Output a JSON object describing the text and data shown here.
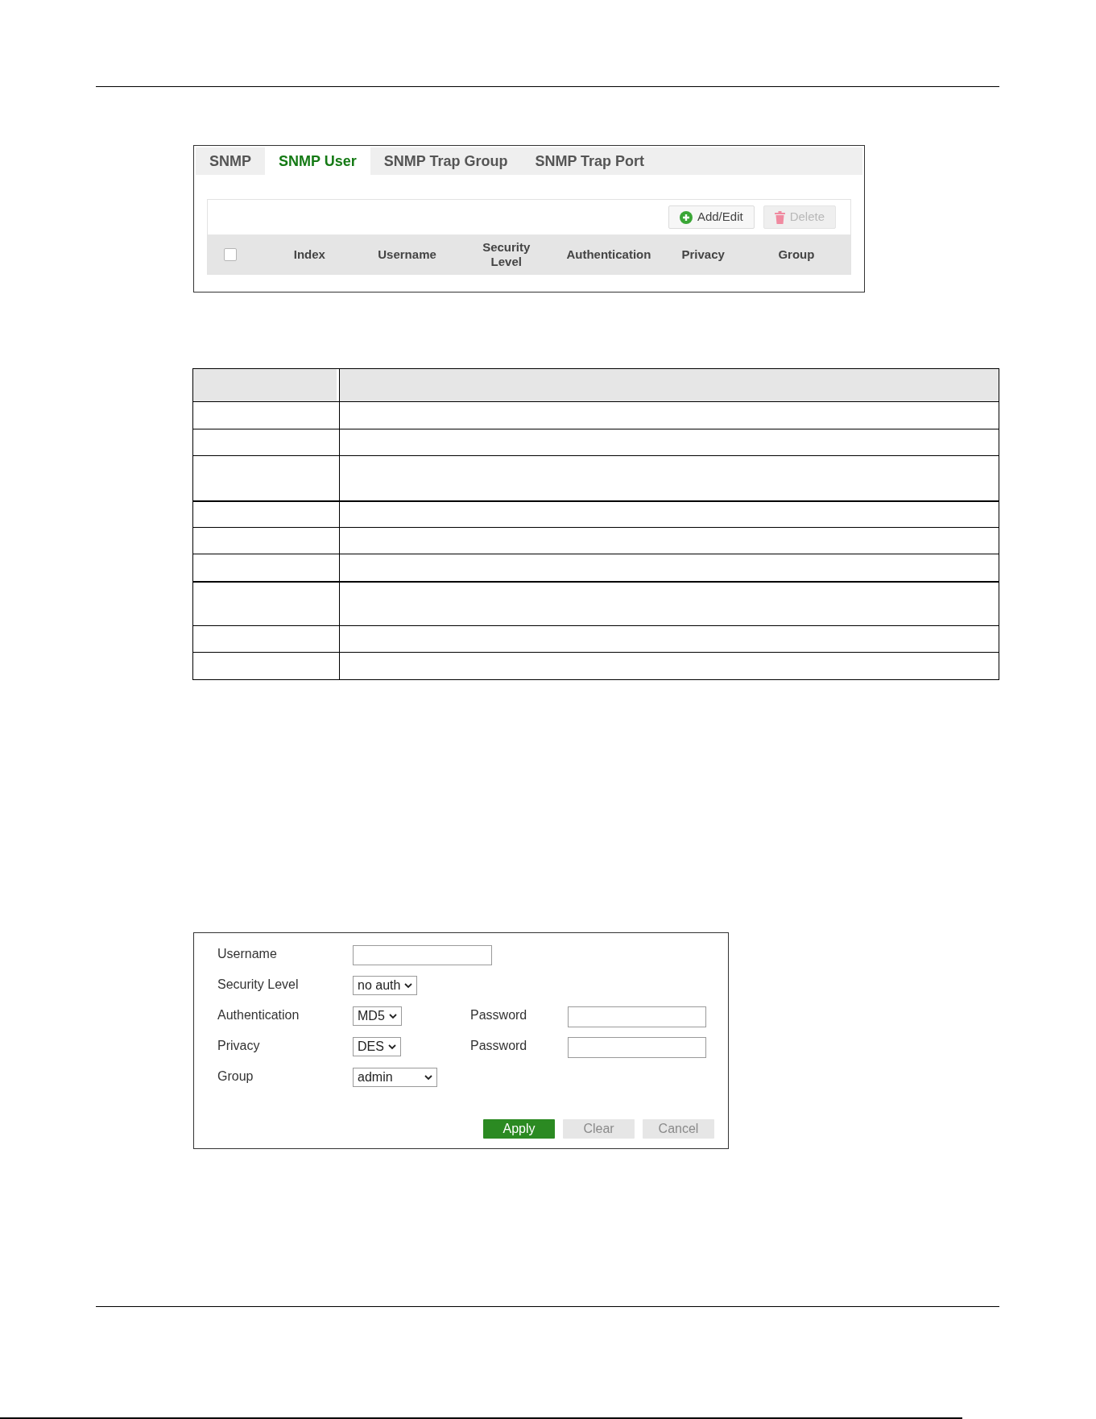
{
  "tabs": [
    {
      "label": "SNMP",
      "selected": false
    },
    {
      "label": "SNMP User",
      "selected": true
    },
    {
      "label": "SNMP Trap Group",
      "selected": false
    },
    {
      "label": "SNMP Trap Port",
      "selected": false
    }
  ],
  "toolbar": {
    "buttons": [
      {
        "label": "Add/Edit",
        "kind": "add",
        "disabled": false
      },
      {
        "label": "Delete",
        "kind": "delete",
        "disabled": true
      }
    ]
  },
  "user_table": {
    "select_all": {
      "checked": false
    },
    "columns": [
      "Index",
      "Username",
      "Security Level",
      "Authentication",
      "Privacy",
      "Group"
    ]
  },
  "form": {
    "fields": [
      {
        "label": "Username",
        "kind": "text"
      },
      {
        "label": "Security Level",
        "kind": "select",
        "value": "no auth"
      },
      {
        "label": "Authentication",
        "kind": "select",
        "value": "MD5",
        "password": {
          "label": "Password"
        }
      },
      {
        "label": "Privacy",
        "kind": "select",
        "value": "DES",
        "password": {
          "label": "Password"
        }
      },
      {
        "label": "Group",
        "kind": "select",
        "value": "admin"
      }
    ],
    "buttons": [
      {
        "label": "Apply",
        "kind": "primary"
      },
      {
        "label": "Clear",
        "kind": "secondary"
      },
      {
        "label": "Cancel",
        "kind": "secondary"
      }
    ]
  }
}
